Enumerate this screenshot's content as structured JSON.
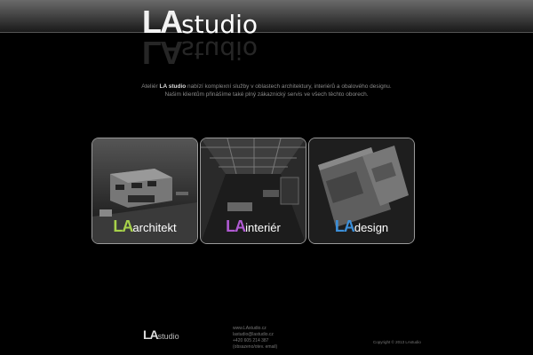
{
  "header": {
    "logo_la": "LA",
    "logo_studio": "studio"
  },
  "intro": {
    "line1_pre": "Ateliér ",
    "line1_brand": "LA studio",
    "line1_post": " nabízí komplexní služby v oblastech architektury, interiérů a obalového designu.",
    "line2": "Našim klientům přinášíme také plný zákaznický servis ve všech těchto oborech."
  },
  "tiles": [
    {
      "prefix": "LA",
      "word": "architekt",
      "color": "#a7d14a"
    },
    {
      "prefix": "LA",
      "word": "interiér",
      "color": "#b05ad3"
    },
    {
      "prefix": "LA",
      "word": "design",
      "color": "#3c8fd9"
    }
  ],
  "footer": {
    "logo_la": "LA",
    "logo_studio": "studio",
    "contacts": [
      "www.LAstudio.cz",
      "lastudio@lastudio.cz",
      "+420 605 214 387",
      "(obsazeno/otev. email)"
    ],
    "copyright": "Copyright © 2013 LAstudio"
  },
  "colors": {
    "background": "#000000",
    "architekt_accent": "#a7d14a",
    "interier_accent": "#b05ad3",
    "design_accent": "#3c8fd9"
  }
}
